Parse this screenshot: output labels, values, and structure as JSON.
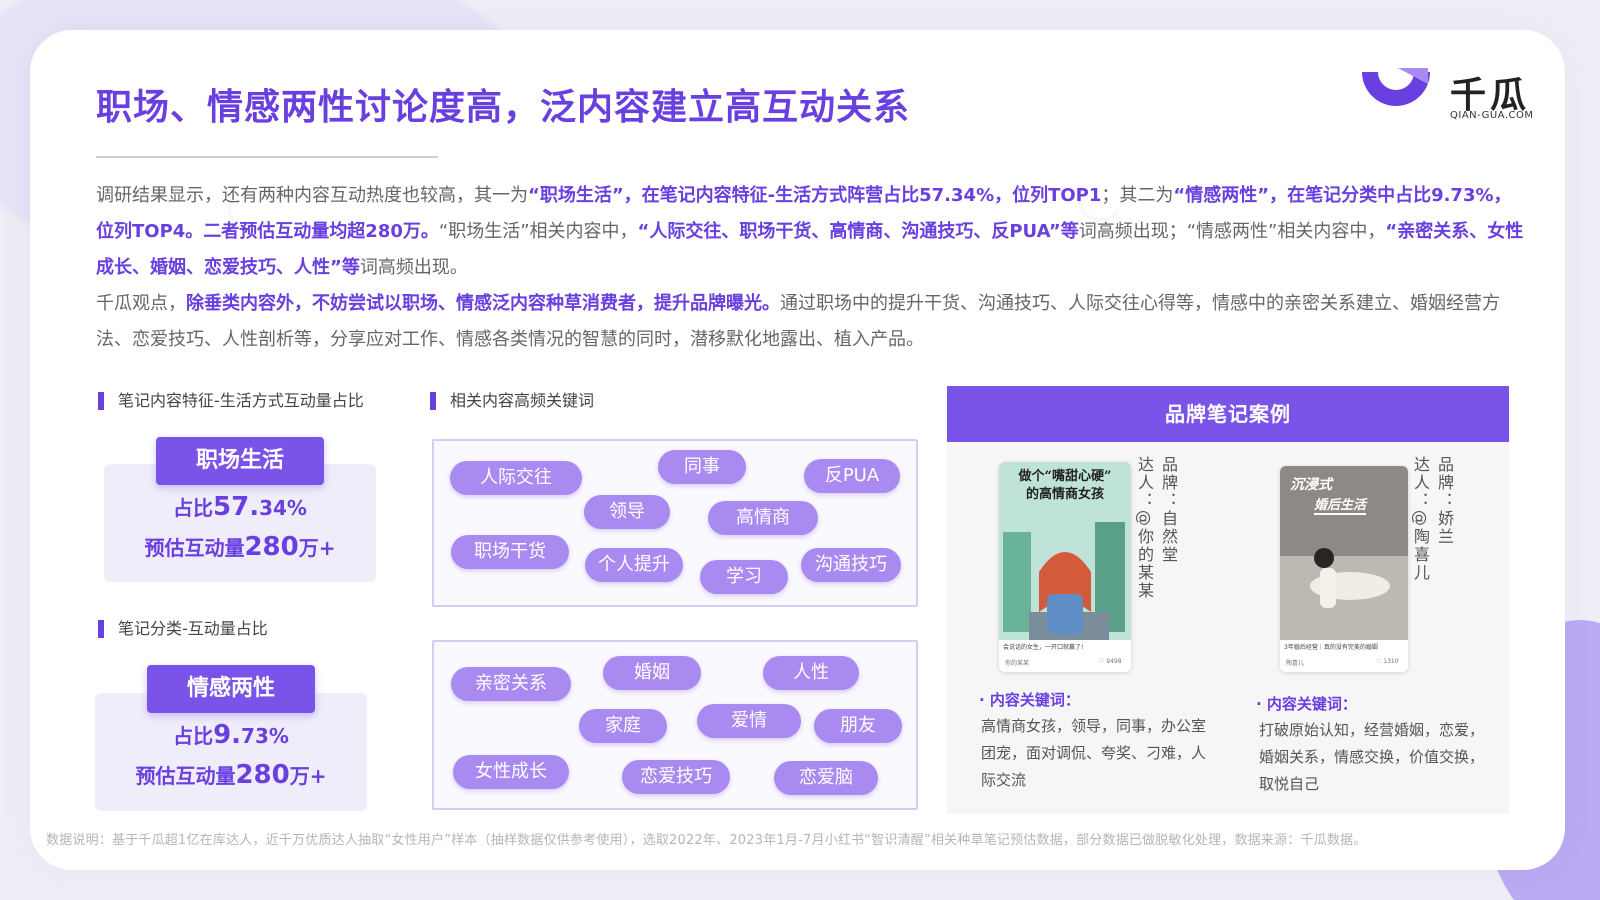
{
  "title": "职场、情感两性讨论度高，泛内容建立高互动关系",
  "logo": {
    "cn": "千瓜",
    "en": "QIAN-GUA.COM",
    "icon": "qiangua-logo-icon"
  },
  "para1": {
    "t1": "调研结果显示，还有两种内容互动热度也较高，其一为",
    "b1": "“职场生活”，在笔记内容特征-生活方式阵营占比57.34%，位列TOP1",
    "t2": "；其二为",
    "b2": "“情感两性”，在笔记分类中占比9.73%，位列TOP4。二者预估互动量均超280万。",
    "t3": "“职场生活”相关内容中，",
    "b3": "“人际交往、职场干货、高情商、沟通技巧、反PUA”等",
    "t4": "词高频出现；“情感两性”相关内容中，",
    "b4": "“亲密关系、女性成长、婚姻、恋爱技巧、人性”等",
    "t5": "词高频出现。"
  },
  "para2": {
    "t1": "千瓜观点，",
    "b1": "除垂类内容外，不妨尝试以职场、情感泛内容种草消费者，提升品牌曝光。",
    "t2": "通过职场中的提升干货、沟通技巧、人际交往心得等，情感中的亲密关系建立、婚姻经营方法、恋爱技巧、人性剖析等，分享应对工作、情感各类情况的智慧的同时，潜移默化地露出、植入产品。"
  },
  "section1": {
    "label": "笔记内容特征-生活方式互动量占比",
    "pill": "职场生活",
    "ratio_prefix": "占比",
    "ratio_value": "57.",
    "ratio_small": "34%",
    "interact_prefix": "预估互动量",
    "interact_value": "280",
    "interact_suffix": "万+"
  },
  "section2": {
    "label": "笔记分类-互动量占比",
    "pill": "情感两性",
    "ratio_prefix": "占比",
    "ratio_value": "9.",
    "ratio_small": "73%",
    "interact_prefix": "预估互动量",
    "interact_value": "280",
    "interact_suffix": "万+"
  },
  "keywords_label": "相关内容高频关键词",
  "keywords1": [
    "人际交往",
    "同事",
    "反PUA",
    "领导",
    "高情商",
    "职场干货",
    "个人提升",
    "学习",
    "沟通技巧"
  ],
  "keywords2": [
    "亲密关系",
    "婚姻",
    "人性",
    "家庭",
    "爱情",
    "朋友",
    "女性成长",
    "恋爱技巧",
    "恋爱脑"
  ],
  "brand": {
    "header": "品牌笔记案例",
    "case1": {
      "brand_line": "品牌：自然堂",
      "kol_line": "达人：@你的某某",
      "img_title_1": "做个“嘴甜心硬”",
      "img_title_2": "的高情商女孩",
      "img_caption": "会说话的女生，一开口就赢了!",
      "img_user": "你的某某",
      "img_likes": "♡ 9498",
      "kw_title": "· 内容关键词：",
      "kw_text": "高情商女孩，领导，同事，办公室团宠，面对调侃、夸奖、刁难，人际交流"
    },
    "case2": {
      "brand_line": "品牌：娇兰",
      "kol_line": "达人：@陶喜儿",
      "img_title_1": "沉浸式",
      "img_title_2": "婚后生活",
      "img_caption": "3年婚后经营｜真的没有完美的婚姻",
      "img_user": "陶喜儿",
      "img_likes": "♡ 1310",
      "kw_title": "· 内容关键词：",
      "kw_text": "打破原始认知，经营婚姻，恋爱，婚姻关系，情感交换，价值交换，取悦自己"
    }
  },
  "footer": "数据说明：基于千瓜超1亿在库达人，近千万优质达人抽取“女性用户”样本（抽样数据仅供参考使用），选取2022年、2023年1月-7月小红书“智识清醒”相关种草笔记预估数据，部分数据已做脱敏化处理，数据来源：千瓜数据。",
  "colors": {
    "accent": "#6a3fe0",
    "pill": "#a98af0",
    "header": "#7a54e8"
  }
}
